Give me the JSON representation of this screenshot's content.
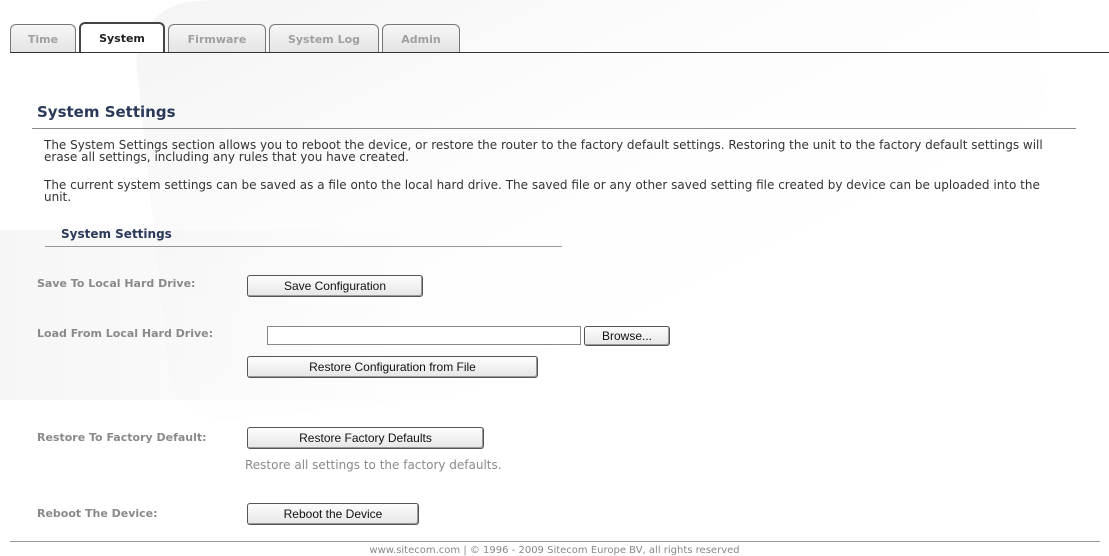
{
  "tabs": [
    {
      "label": "Time",
      "active": false
    },
    {
      "label": "System",
      "active": true
    },
    {
      "label": "Firmware",
      "active": false
    },
    {
      "label": "System Log",
      "active": false
    },
    {
      "label": "Admin",
      "active": false
    }
  ],
  "page": {
    "title": "System Settings",
    "description1": "The System Settings section allows you to reboot the device, or restore the router to the factory default settings. Restoring the unit to the factory default settings will erase all settings, including any rules that you have created.",
    "description2": "The current system settings can be saved as a file onto the local hard drive. The saved file or any other saved setting file created by device can be uploaded into the unit.",
    "section_title": "System Settings"
  },
  "save": {
    "label": "Save To Local Hard Drive:",
    "button": "Save Configuration"
  },
  "load": {
    "label": "Load From Local Hard Drive:",
    "file_value": "",
    "browse_button": "Browse...",
    "restore_button": "Restore Configuration from File"
  },
  "factory": {
    "label": "Restore To Factory Default:",
    "button": "Restore Factory Defaults",
    "hint": "Restore all settings to the factory defaults."
  },
  "reboot": {
    "label": "Reboot The Device:",
    "button": "Reboot the Device"
  },
  "footer": {
    "text": "www.sitecom.com | © 1996 - 2009 Sitecom Europe BV, all rights reserved"
  }
}
